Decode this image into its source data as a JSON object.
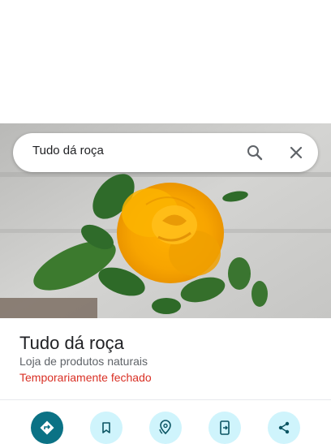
{
  "search": {
    "query": "Tudo dá roça",
    "icons": [
      "search-icon",
      "close-icon"
    ]
  },
  "photo": {
    "subject": "yellow-orange rose"
  },
  "place": {
    "name": "Tudo dá roça",
    "category": "Loja de produtos naturais",
    "status": "Temporariamente fechado",
    "status_color": "#d93025"
  },
  "actions": {
    "icons": [
      "directions-icon",
      "bookmark-icon",
      "nearby-icon",
      "send-to-phone-icon",
      "share-icon"
    ],
    "primary_color": "#0b7285",
    "secondary_color": "#cff4fc"
  }
}
